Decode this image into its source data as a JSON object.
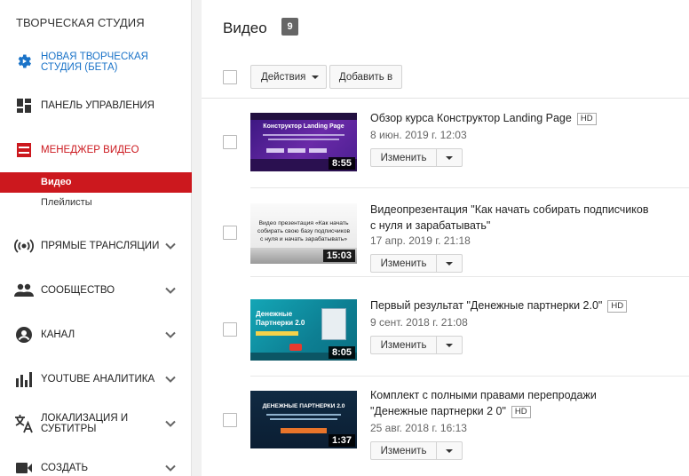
{
  "sidebar": {
    "title": "ТВОРЧЕСКАЯ СТУДИЯ",
    "items": [
      {
        "label_line1": "НОВАЯ ТВОРЧЕСКАЯ",
        "label_line2": "СТУДИЯ (БЕТА)",
        "icon": "gear-icon"
      },
      {
        "label": "ПАНЕЛЬ УПРАВЛЕНИЯ",
        "icon": "dashboard-icon"
      },
      {
        "label": "МЕНЕДЖЕР ВИДЕО",
        "icon": "video-manager-icon"
      },
      {
        "label": "ПРЯМЫЕ ТРАНСЛЯЦИИ",
        "icon": "live-broadcast-icon"
      },
      {
        "label": "СООБЩЕСТВО",
        "icon": "community-icon"
      },
      {
        "label": "КАНАЛ",
        "icon": "channel-icon"
      },
      {
        "label": "YOUTUBE АНАЛИТИКА",
        "icon": "analytics-icon"
      },
      {
        "label_line1": "ЛОКАЛИЗАЦИЯ И",
        "label_line2": "СУБТИТРЫ",
        "icon": "translate-icon"
      },
      {
        "label": "СОЗДАТЬ",
        "icon": "create-icon"
      }
    ],
    "sub_items": [
      {
        "label": "Видео",
        "active": true
      },
      {
        "label": "Плейлисты",
        "active": false
      }
    ]
  },
  "main": {
    "title": "Видео",
    "count": "9",
    "toolbar": {
      "actions_label": "Действия",
      "add_to_label": "Добавить в"
    },
    "edit_label": "Изменить",
    "hd_label": "HD",
    "videos": [
      {
        "title": "Обзор курса Конструктор Landing Page",
        "hd": true,
        "date": "8 июн. 2019 г. 12:03",
        "duration": "8:55",
        "thumb_heading": "Конструктор Landing Page"
      },
      {
        "title_line1": "Видеопрезентация \"Как начать собирать подписчиков",
        "title_line2": "с нуля и зарабатывать\"",
        "hd": false,
        "date": "17 апр. 2019 г. 21:18",
        "duration": "15:03",
        "thumb_line1": "Видео презентация «Как начать",
        "thumb_line2": "собирать свою базу подписчиков",
        "thumb_line3": "с нуля и начать зарабатывать»"
      },
      {
        "title": "Первый результат \"Денежные партнерки 2.0\"",
        "hd": true,
        "date": "9 сент. 2018 г. 21:08",
        "duration": "8:05",
        "thumb_line1": "Денежные",
        "thumb_line2": "Партнерки 2.0"
      },
      {
        "title_line1": "Комплект с полными правами перепродажи",
        "title_line2": "\"Денежные партнерки 2 0\"",
        "hd": true,
        "date": "25 авг. 2018 г. 16:13",
        "duration": "1:37",
        "thumb_heading": "ДЕНЕЖНЫЕ ПАРТНЕРКИ 2.0"
      }
    ]
  },
  "colors": {
    "accent_red": "#cc181e",
    "link_blue": "#1a73c8"
  }
}
